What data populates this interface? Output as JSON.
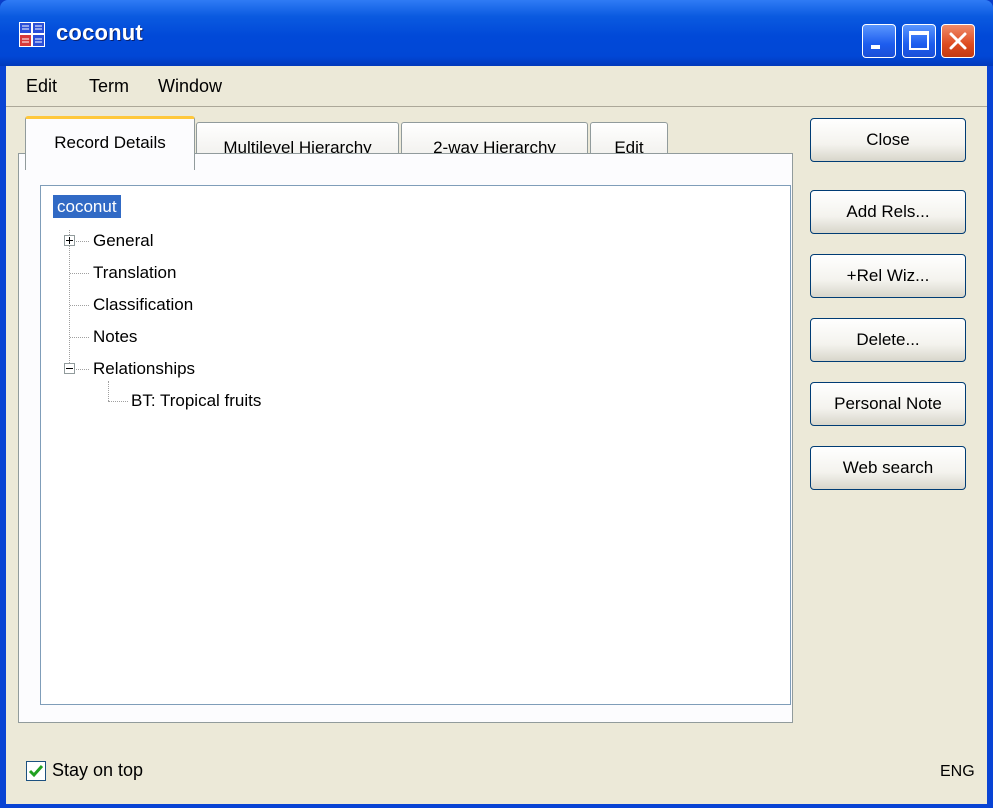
{
  "window": {
    "title": "coconut"
  },
  "menu": {
    "items": [
      "Edit",
      "Term",
      "Window"
    ]
  },
  "tabs": [
    {
      "label": "Record Details",
      "active": true
    },
    {
      "label": "Multilevel Hierarchy",
      "active": false
    },
    {
      "label": "2-way Hierarchy",
      "active": false
    },
    {
      "label": "Edit",
      "active": false
    }
  ],
  "tree": {
    "root": "coconut",
    "nodes": [
      "General",
      "Translation",
      "Classification",
      "Notes",
      "Relationships"
    ],
    "child": "BT: Tropical fruits"
  },
  "buttons": {
    "close": "Close",
    "add_rels": "Add Rels...",
    "rel_wiz": "+Rel Wiz...",
    "delete": "Delete...",
    "personal_note": "Personal Note",
    "web_search": "Web search"
  },
  "status": {
    "stay_on_top": "Stay on top",
    "stay_on_top_checked": true,
    "language": "ENG"
  },
  "colors": {
    "titlebar": "#0149d8",
    "selection": "#316ac5",
    "active_tab_accent": "#ffc83c",
    "checkmark": "#21a121"
  }
}
